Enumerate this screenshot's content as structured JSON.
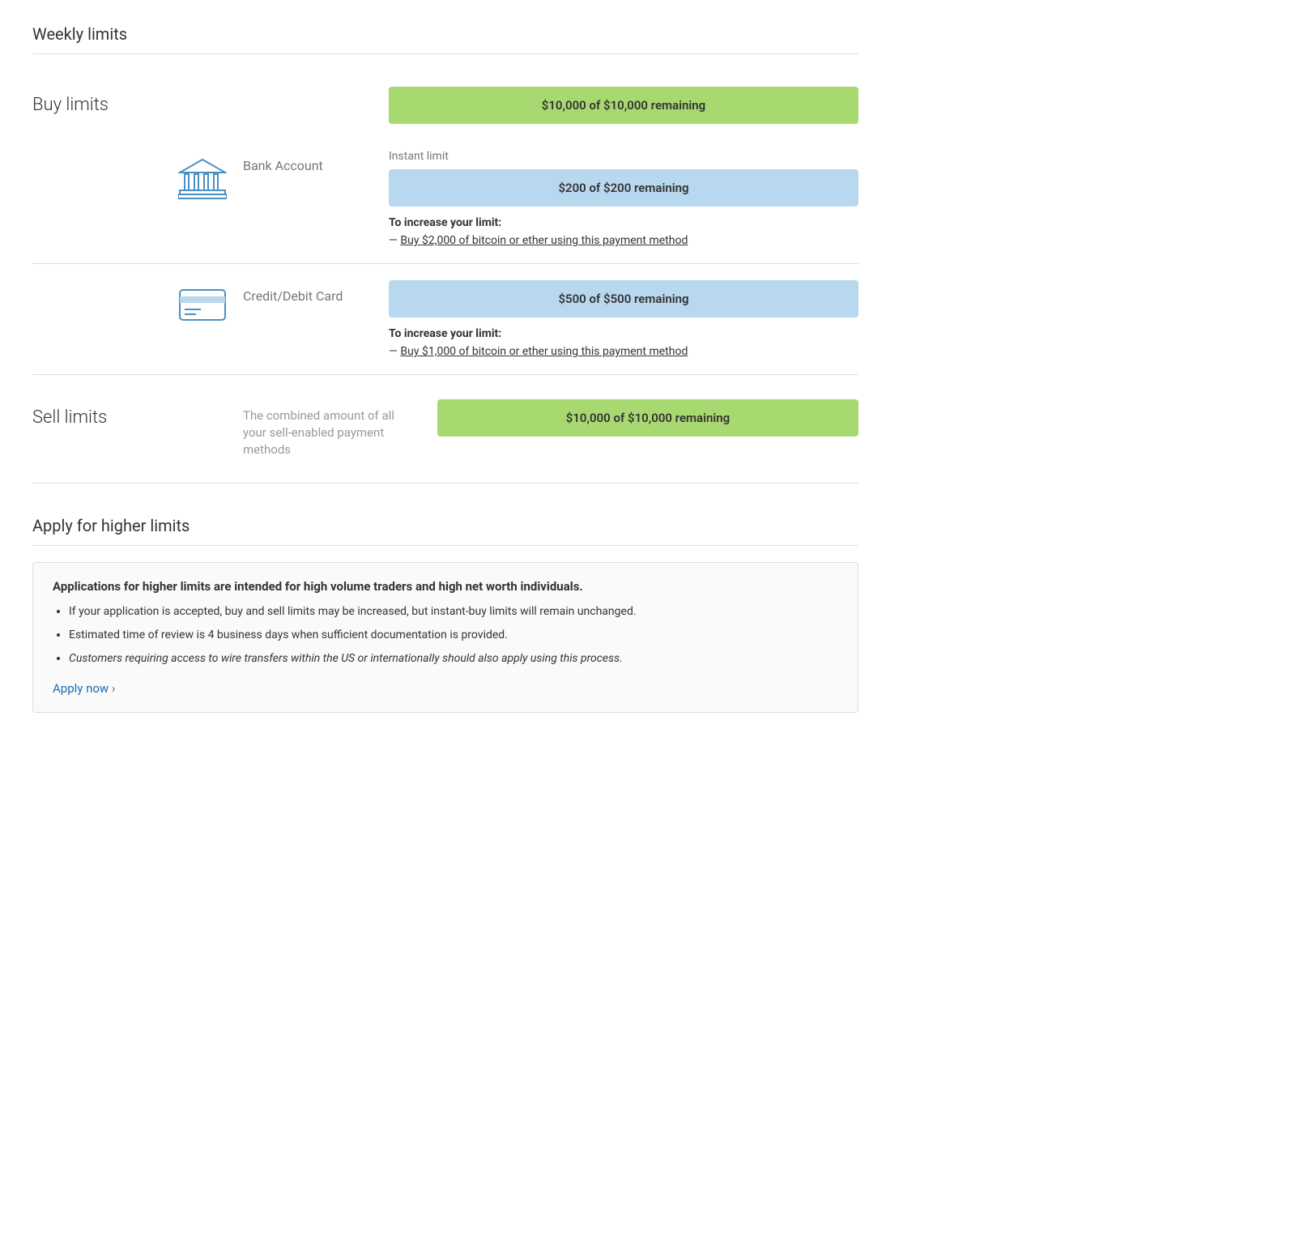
{
  "page": {
    "weekly_limits_title": "Weekly limits",
    "buy_limits_label": "Buy limits",
    "sell_limits_label": "Sell limits",
    "apply_section_title": "Apply for higher limits"
  },
  "buy_limits": {
    "weekly_bar_text": "$10,000 of $10,000 remaining",
    "bank_account": {
      "method_name": "Bank Account",
      "instant_limit_label": "Instant limit",
      "instant_bar_text": "$200 of $200 remaining",
      "increase_title": "To increase your limit:",
      "increase_dash": "—",
      "increase_link_text": "Buy $2,000 of bitcoin or ether using this payment method"
    },
    "credit_card": {
      "method_name": "Credit/Debit Card",
      "bar_text": "$500 of $500 remaining",
      "increase_title": "To increase your limit:",
      "increase_dash": "—",
      "increase_link_text": "Buy $1,000 of bitcoin or ether using this payment method"
    }
  },
  "sell_limits": {
    "description": "The combined amount of all your sell-enabled payment methods",
    "bar_text": "$10,000 of $10,000 remaining"
  },
  "apply_section": {
    "bold_text": "Applications for higher limits are intended for high volume traders and high net worth individuals.",
    "bullet_1": "If your application is accepted, buy and sell limits may be increased, but instant-buy limits will remain unchanged.",
    "bullet_2": "Estimated time of review is 4 business days when sufficient documentation is provided.",
    "bullet_3": "Customers requiring access to wire transfers within the US or internationally should also apply using this process.",
    "apply_now_text": "Apply now ›"
  }
}
